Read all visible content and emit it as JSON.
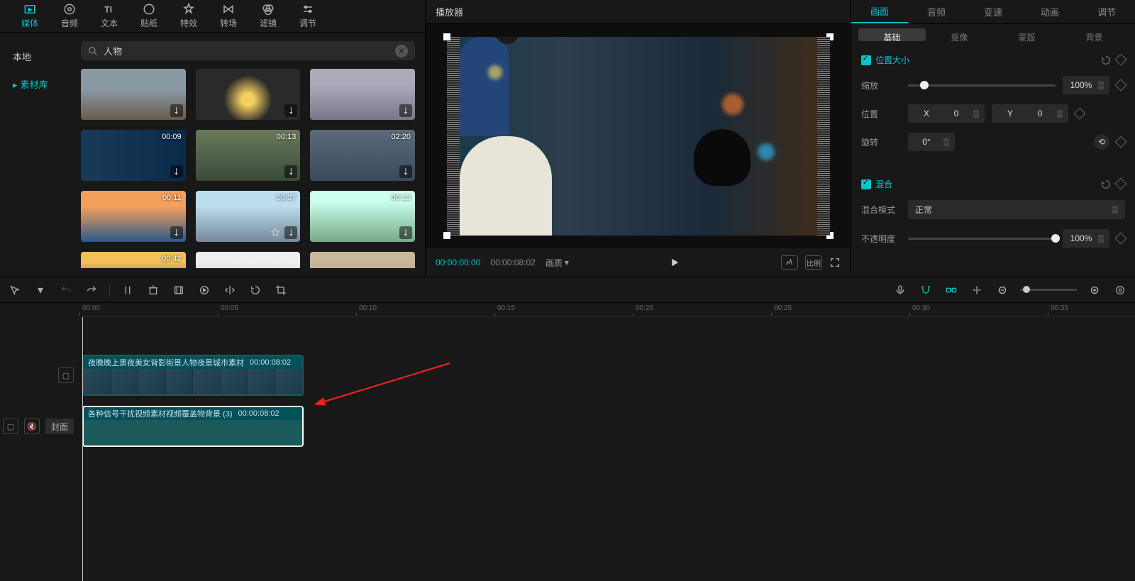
{
  "toolbar": {
    "tabs": [
      {
        "label": "媒体",
        "icon": "media-icon"
      },
      {
        "label": "音频",
        "icon": "audio-icon"
      },
      {
        "label": "文本",
        "icon": "text-icon"
      },
      {
        "label": "贴纸",
        "icon": "sticker-icon"
      },
      {
        "label": "特效",
        "icon": "effect-icon"
      },
      {
        "label": "转场",
        "icon": "transition-icon"
      },
      {
        "label": "滤镜",
        "icon": "filter-icon"
      },
      {
        "label": "调节",
        "icon": "adjust-icon"
      }
    ],
    "active": 0
  },
  "left_nav": {
    "items": [
      "本地",
      "素材库"
    ],
    "active": 1
  },
  "search": {
    "value": "人物",
    "icon": "search-icon"
  },
  "thumbs": [
    {
      "dur": "",
      "star": false
    },
    {
      "dur": "",
      "star": false
    },
    {
      "dur": "",
      "star": false
    },
    {
      "dur": "00:09",
      "star": false
    },
    {
      "dur": "00:13",
      "star": false
    },
    {
      "dur": "02:20",
      "star": false
    },
    {
      "dur": "00:11",
      "star": false
    },
    {
      "dur": "00:07",
      "star": true
    },
    {
      "dur": "00:13",
      "star": false
    },
    {
      "dur": "00:42",
      "star": false
    },
    {
      "dur": "",
      "star": false
    },
    {
      "dur": "",
      "star": false
    }
  ],
  "preview": {
    "title": "播放器",
    "time_current": "00:00:00:00",
    "time_duration": "00:00:08:02",
    "quality_label": "画质",
    "ratio_btn": "比例"
  },
  "inspector": {
    "tabs": [
      "画面",
      "音频",
      "变速",
      "动画",
      "调节"
    ],
    "active": 0,
    "subtabs": [
      "基础",
      "抠像",
      "蒙版",
      "背景"
    ],
    "sub_active": 0,
    "section_pos": "位置大小",
    "scale_label": "缩放",
    "scale_value": "100%",
    "pos_label": "位置",
    "pos_x_label": "X",
    "pos_x": "0",
    "pos_y_label": "Y",
    "pos_y": "0",
    "rotate_label": "旋转",
    "rotate_value": "0°",
    "section_blend": "混合",
    "blend_mode_label": "混合模式",
    "blend_mode_value": "正常",
    "opacity_label": "不透明度",
    "opacity_value": "100%"
  },
  "timeline": {
    "ruler": [
      "00:00",
      "00:05",
      "00:10",
      "00:15",
      "00:20",
      "00:25",
      "00:30",
      "00:35"
    ],
    "cover_btn": "封面",
    "clip1": {
      "title": "夜晚晚上黑夜美女背影街景人物夜景城市素材",
      "dur": "00:00:08:02"
    },
    "clip2": {
      "title": "各种信号干扰视频素材视频覆盖物背景 (3)",
      "dur": "00:00:08:02"
    }
  }
}
